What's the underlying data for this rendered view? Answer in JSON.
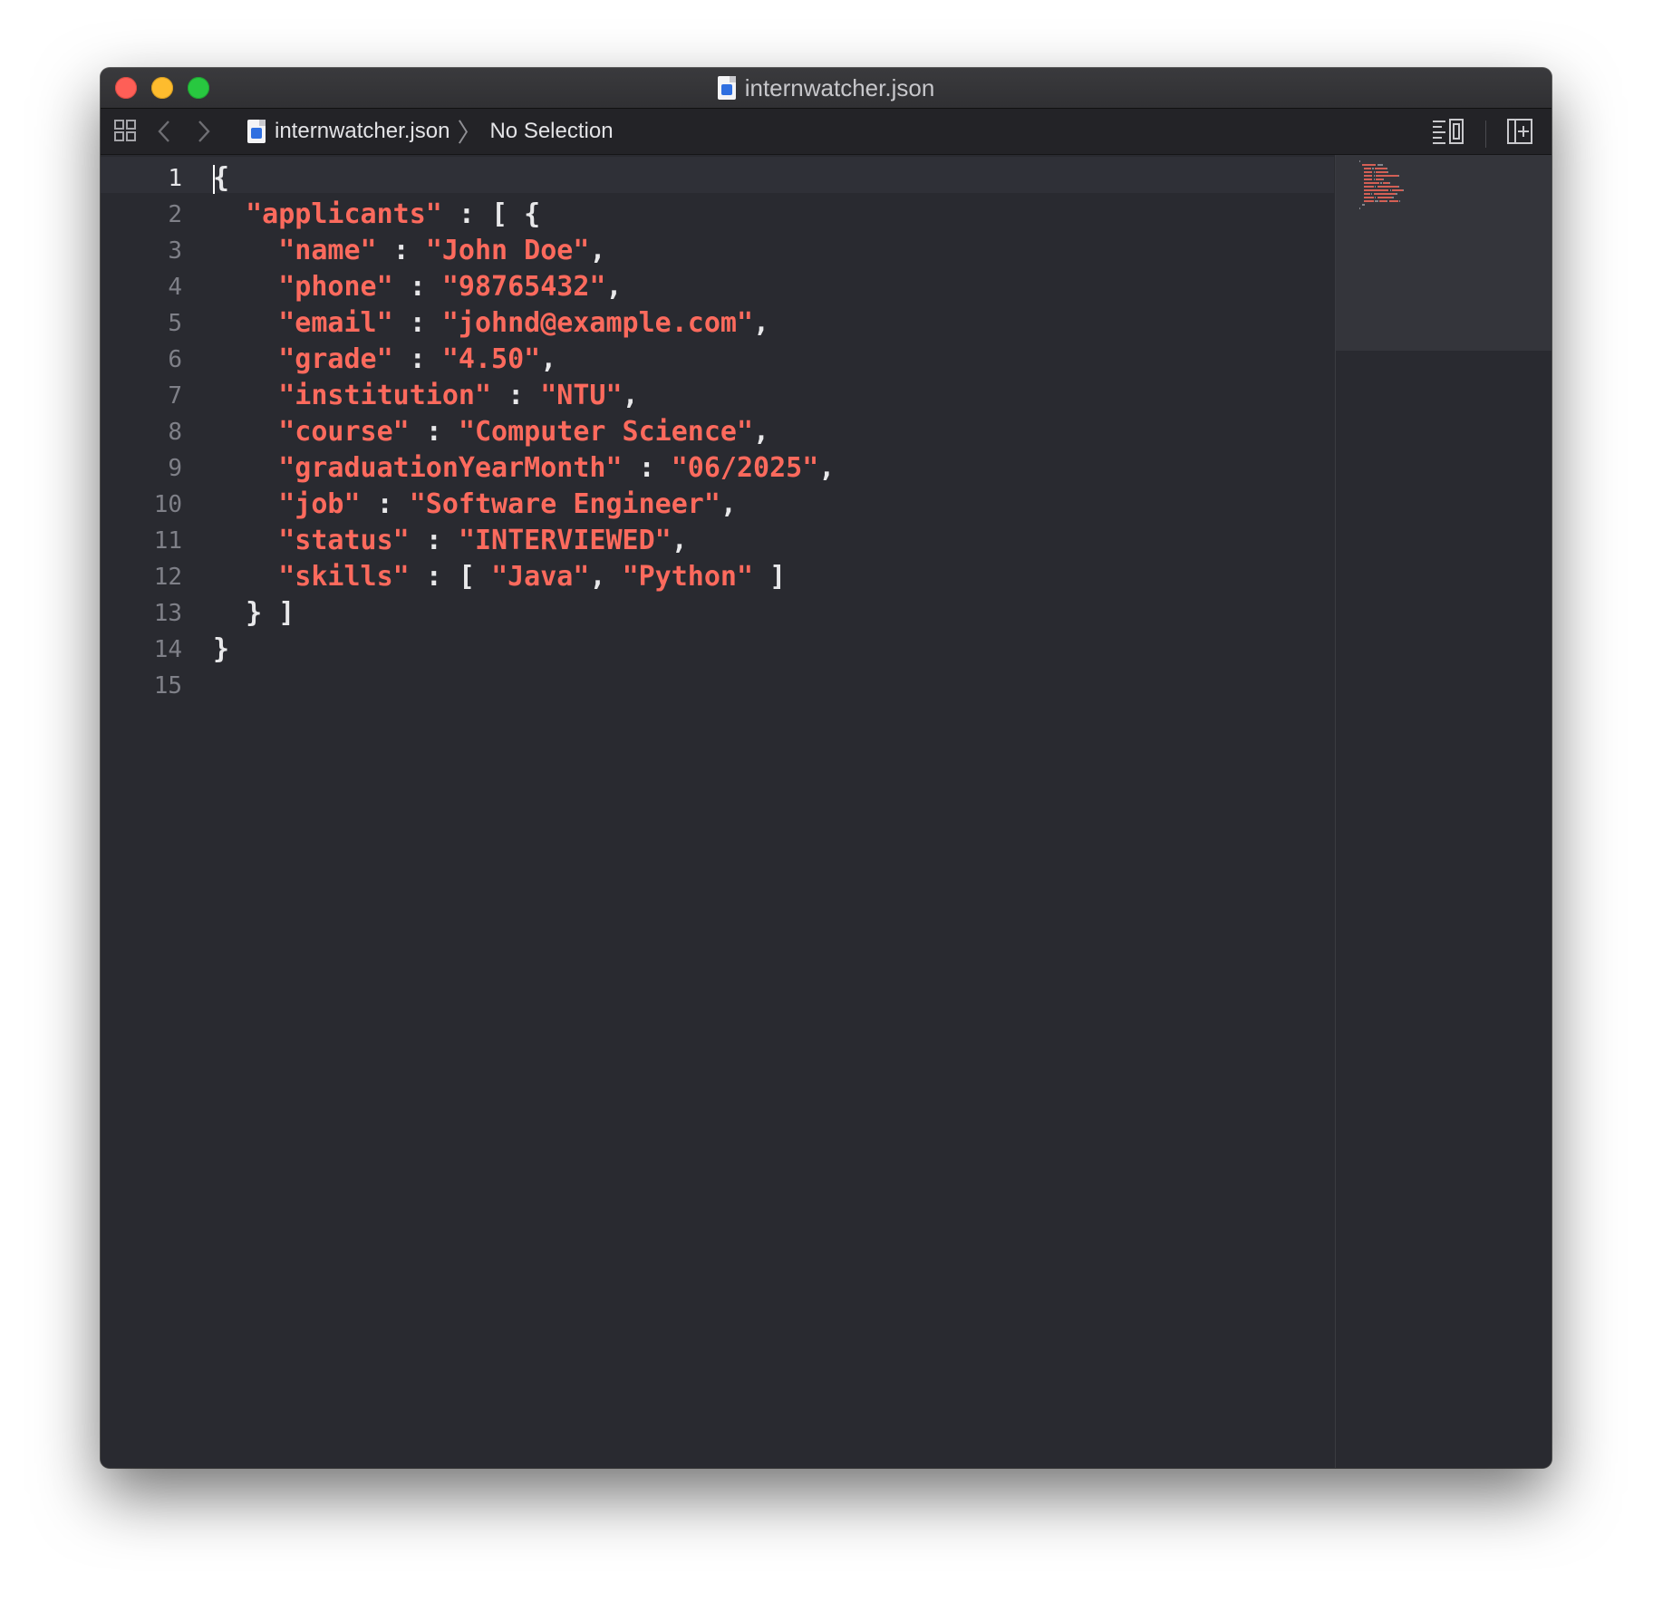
{
  "window": {
    "title": "internwatcher.json",
    "traffic_lights": [
      "close",
      "minimize",
      "zoom"
    ]
  },
  "jumpbar": {
    "grid_icon": "related-items-grid-icon",
    "back_icon": "chevron-left-icon",
    "forward_icon": "chevron-right-icon",
    "file_name": "internwatcher.json",
    "separator": "〉",
    "selection": "No Selection",
    "right_icons": [
      "editor-options-icon",
      "add-editor-icon"
    ]
  },
  "editor": {
    "line_numbers": [
      "1",
      "2",
      "3",
      "4",
      "5",
      "6",
      "7",
      "8",
      "9",
      "10",
      "11",
      "12",
      "13",
      "14",
      "15"
    ],
    "active_line": 1,
    "lines": [
      [
        {
          "t": "pun",
          "v": "{"
        }
      ],
      [
        {
          "t": "pun",
          "v": "  "
        },
        {
          "t": "str",
          "v": "\"applicants\""
        },
        {
          "t": "pun",
          "v": " : [ {"
        }
      ],
      [
        {
          "t": "pun",
          "v": "    "
        },
        {
          "t": "str",
          "v": "\"name\""
        },
        {
          "t": "pun",
          "v": " : "
        },
        {
          "t": "str",
          "v": "\"John Doe\""
        },
        {
          "t": "pun",
          "v": ","
        }
      ],
      [
        {
          "t": "pun",
          "v": "    "
        },
        {
          "t": "str",
          "v": "\"phone\""
        },
        {
          "t": "pun",
          "v": " : "
        },
        {
          "t": "str",
          "v": "\"98765432\""
        },
        {
          "t": "pun",
          "v": ","
        }
      ],
      [
        {
          "t": "pun",
          "v": "    "
        },
        {
          "t": "str",
          "v": "\"email\""
        },
        {
          "t": "pun",
          "v": " : "
        },
        {
          "t": "str",
          "v": "\"johnd@example.com\""
        },
        {
          "t": "pun",
          "v": ","
        }
      ],
      [
        {
          "t": "pun",
          "v": "    "
        },
        {
          "t": "str",
          "v": "\"grade\""
        },
        {
          "t": "pun",
          "v": " : "
        },
        {
          "t": "str",
          "v": "\"4.50\""
        },
        {
          "t": "pun",
          "v": ","
        }
      ],
      [
        {
          "t": "pun",
          "v": "    "
        },
        {
          "t": "str",
          "v": "\"institution\""
        },
        {
          "t": "pun",
          "v": " : "
        },
        {
          "t": "str",
          "v": "\"NTU\""
        },
        {
          "t": "pun",
          "v": ","
        }
      ],
      [
        {
          "t": "pun",
          "v": "    "
        },
        {
          "t": "str",
          "v": "\"course\""
        },
        {
          "t": "pun",
          "v": " : "
        },
        {
          "t": "str",
          "v": "\"Computer Science\""
        },
        {
          "t": "pun",
          "v": ","
        }
      ],
      [
        {
          "t": "pun",
          "v": "    "
        },
        {
          "t": "str",
          "v": "\"graduationYearMonth\""
        },
        {
          "t": "pun",
          "v": " : "
        },
        {
          "t": "str",
          "v": "\"06/2025\""
        },
        {
          "t": "pun",
          "v": ","
        }
      ],
      [
        {
          "t": "pun",
          "v": "    "
        },
        {
          "t": "str",
          "v": "\"job\""
        },
        {
          "t": "pun",
          "v": " : "
        },
        {
          "t": "str",
          "v": "\"Software Engineer\""
        },
        {
          "t": "pun",
          "v": ","
        }
      ],
      [
        {
          "t": "pun",
          "v": "    "
        },
        {
          "t": "str",
          "v": "\"status\""
        },
        {
          "t": "pun",
          "v": " : "
        },
        {
          "t": "str",
          "v": "\"INTERVIEWED\""
        },
        {
          "t": "pun",
          "v": ","
        }
      ],
      [
        {
          "t": "pun",
          "v": "    "
        },
        {
          "t": "str",
          "v": "\"skills\""
        },
        {
          "t": "pun",
          "v": " : [ "
        },
        {
          "t": "str",
          "v": "\"Java\""
        },
        {
          "t": "pun",
          "v": ", "
        },
        {
          "t": "str",
          "v": "\"Python\""
        },
        {
          "t": "pun",
          "v": " ]"
        }
      ],
      [
        {
          "t": "pun",
          "v": "  } ]"
        }
      ],
      [
        {
          "t": "pun",
          "v": "}"
        }
      ],
      []
    ]
  },
  "colors": {
    "string": "#fc6a5d",
    "punctuation": "#e8e8ea",
    "background": "#292a30",
    "line_number": "#7f8088"
  }
}
